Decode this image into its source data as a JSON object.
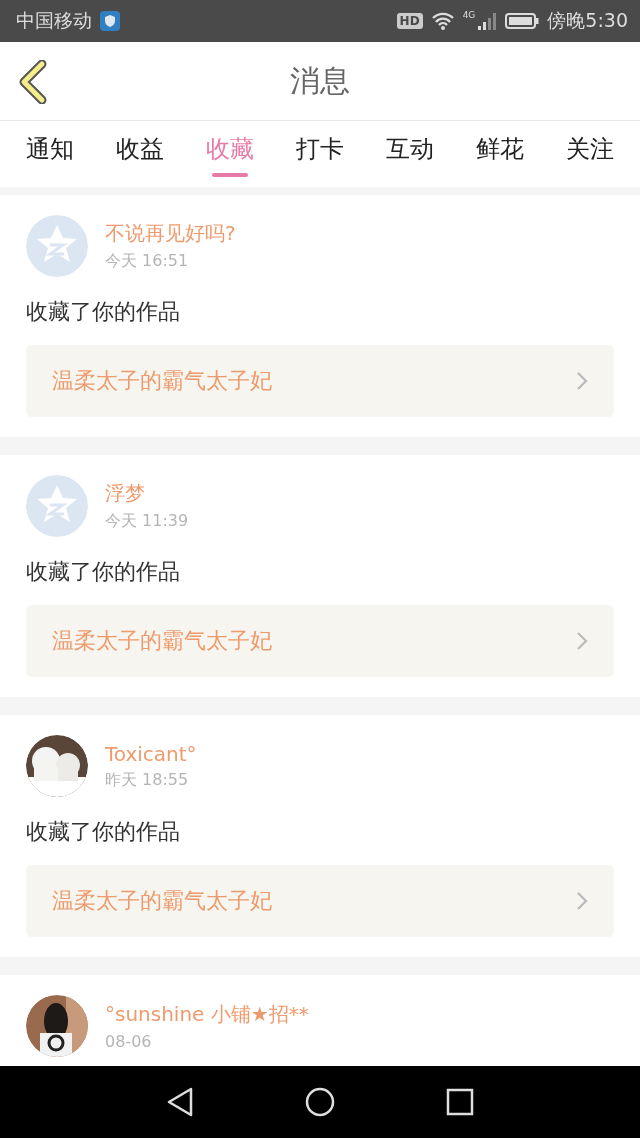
{
  "status_bar": {
    "carrier": "中国移动",
    "hd": "HD",
    "network": "4G",
    "time": "傍晚5:30"
  },
  "header": {
    "title": "消息"
  },
  "tabs": [
    {
      "label": "通知",
      "selected": false
    },
    {
      "label": "收益",
      "selected": false
    },
    {
      "label": "收藏",
      "selected": true
    },
    {
      "label": "打卡",
      "selected": false
    },
    {
      "label": "互动",
      "selected": false
    },
    {
      "label": "鲜花",
      "selected": false
    },
    {
      "label": "关注",
      "selected": false
    }
  ],
  "messages": [
    {
      "kind": "default",
      "name": "不说再见好吗?",
      "time": "今天 16:51",
      "text": "收藏了你的作品",
      "work": "温柔太子的霸气太子妃"
    },
    {
      "kind": "default",
      "name": "浮梦",
      "time": "今天 11:39",
      "text": "收藏了你的作品",
      "work": "温柔太子的霸气太子妃"
    },
    {
      "kind": "picture",
      "name": "Toxicant°",
      "time": "昨天 18:55",
      "text": "收藏了你的作品",
      "work": "温柔太子的霸气太子妃"
    },
    {
      "kind": "picture",
      "name": "°sunshine 小铺★招**",
      "time": "08-06"
    }
  ]
}
